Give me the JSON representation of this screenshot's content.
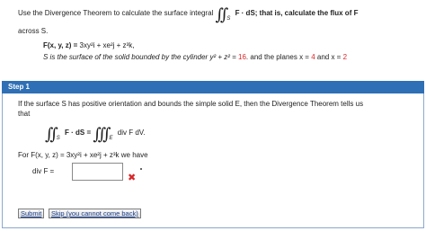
{
  "problem": {
    "instruction_pre": "Use the Divergence Theorem to calculate the surface integral",
    "instruction_integral_sub": "S",
    "instruction_post": "F · dS;  that is, calculate the flux of",
    "instruction_F": "F",
    "across": "across S.",
    "field_lhs": "F(x, y, z) = ",
    "field_rhs": "3xy²i + xe²j + z³k,",
    "surface_pre": "S is the surface of the solid bounded by the cylinder  y² + z² = ",
    "surface_value": "16",
    "surface_mid": ".  and the planes  x = ",
    "x_low": "4",
    "surface_and": " and x = ",
    "x_high": "2"
  },
  "step": {
    "title": "Step 1",
    "text_line1": "If the surface S has positive orientation and bounds the simple solid E, then the Divergence Theorem tells us",
    "text_line2": "that",
    "theorem_lhs_sub": "S",
    "theorem_lhs": "F · dS =",
    "theorem_rhs_sub": "E",
    "theorem_rhs": "div F dV.",
    "for_pre": "For  F(x, y, z) = 3xy²i + xe²j + z³k  we have",
    "div_label": "div F =",
    "div_value": "",
    "status": "incorrect"
  },
  "buttons": {
    "submit": "Submit",
    "skip": "Skip (you cannot come back)"
  },
  "colors": {
    "accent_blue": "#2e6fb5",
    "error_red": "#d9262a",
    "value_red": "#d9262a"
  }
}
